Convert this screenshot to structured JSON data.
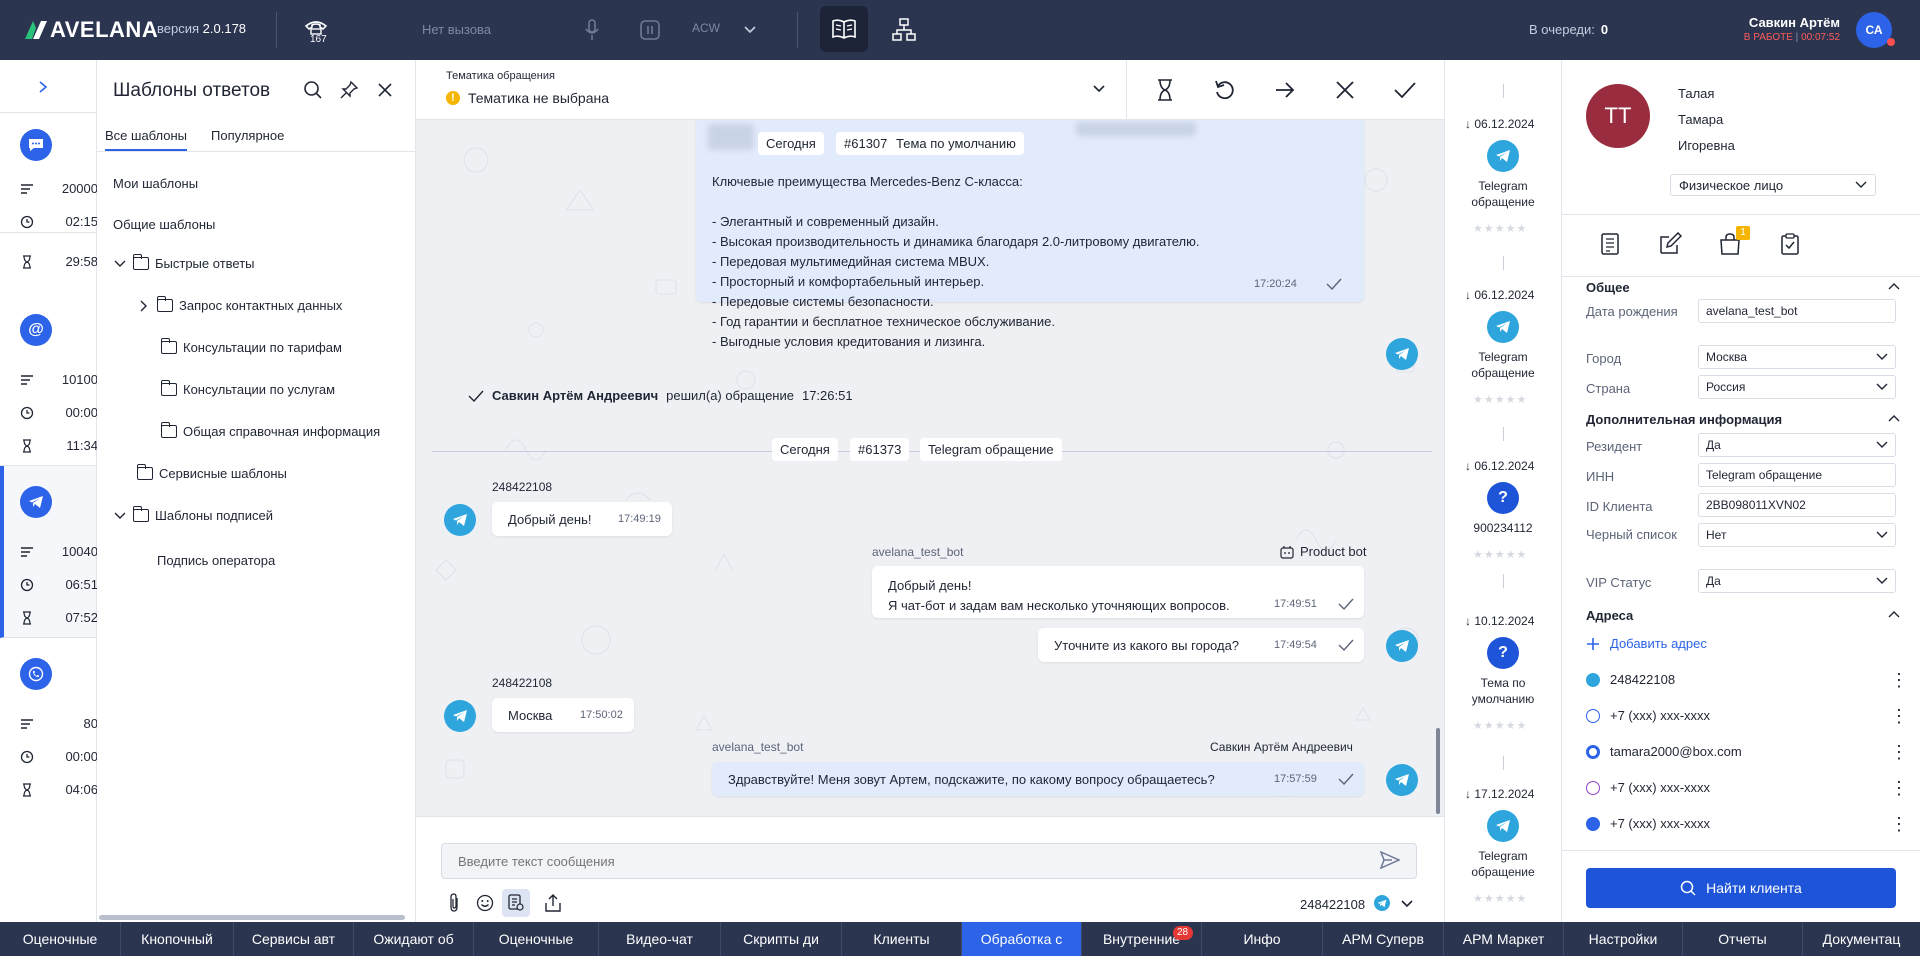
{
  "topbar": {
    "logo": "AVELANA",
    "version_label": "версия",
    "version": "2.0.178",
    "phone_count": "167",
    "call_status": "Нет вызова",
    "acw_label": "ACW",
    "queue_label": "В очереди:",
    "queue_count": "0",
    "user_name": "Савкин Артём",
    "user_status": "В РАБОТЕ",
    "user_timer": "00:07:52",
    "user_initials": "СА"
  },
  "channels": [
    {
      "icon": "chat-icon",
      "count": "20000",
      "time": "02:15",
      "wait": "29:58"
    },
    {
      "icon": "email-icon",
      "count": "10100",
      "time": "00:00",
      "wait": "11:34"
    },
    {
      "icon": "telegram-icon",
      "count": "10040",
      "time": "06:51",
      "wait": "07:52"
    },
    {
      "icon": "phone-icon",
      "count": "80",
      "time": "00:00",
      "wait": "04:06"
    }
  ],
  "templates": {
    "title": "Шаблоны ответов",
    "tabs": [
      "Все шаблоны",
      "Популярное"
    ],
    "my": "Мои шаблоны",
    "common": "Общие шаблоны",
    "tree": [
      "Быстрые ответы",
      "Запрос контактных данных",
      "Консультации по тарифам",
      "Консультации по услугам",
      "Общая справочная информация",
      "Сервисные шаблоны",
      "Шаблоны подписей",
      "Подпись оператора"
    ]
  },
  "topic": {
    "label": "Тематика обращения",
    "value": "Тематика не выбрана"
  },
  "chat": {
    "chips1": [
      "Сегодня",
      "#61307",
      "Тема по умолчанию"
    ],
    "long_msg": [
      "Ключевые преимущества Mercedes-Benz C-класса:",
      "- Элегантный и современный дизайн.",
      "- Высокая производительность и динамика благодаря 2.0-литровому двигателю.",
      "- Передовая мультимедийная система MBUX.",
      "- Просторный и комфортабельный интерьер.",
      "- Передовые системы безопасности.",
      "- Год гарантии и бесплатное техническое обслуживание.",
      "- Выгодные условия кредитования и лизинга."
    ],
    "long_msg_time": "17:20:24",
    "resolved_name": "Савкин Артём Андреевич",
    "resolved_text": "решил(а) обращение",
    "resolved_time": "17:26:51",
    "chips2": [
      "Сегодня",
      "#61373",
      "Telegram обращение"
    ],
    "client_id": "248422108",
    "m1_text": "Добрый день!",
    "m1_time": "17:49:19",
    "bot_name": "avelana_test_bot",
    "bot_label": "Product bot",
    "m2_line1": "Добрый день!",
    "m2_line2": "Я чат-бот и задам вам несколько уточняющих вопросов.",
    "m2_time": "17:49:51",
    "m3_text": "Уточните из какого вы города?",
    "m3_time": "17:49:54",
    "m4_text": "Москва",
    "m4_time": "17:50:02",
    "operator_name": "Савкин Артём Андреевич",
    "m5_text": "Здравствуйте! Меня зовут Артем, подскажите, по какому вопросу обращаетесь?",
    "m5_time": "17:57:59"
  },
  "composer": {
    "placeholder": "Введите текст сообщения",
    "recipient": "248422108"
  },
  "history": [
    {
      "date": "06.12.2024",
      "icon": "telegram-icon",
      "name": "Telegram обращение"
    },
    {
      "date": "06.12.2024",
      "icon": "telegram-icon",
      "name": "Telegram обращение"
    },
    {
      "date": "06.12.2024",
      "icon": "question-icon",
      "name": "900234112"
    },
    {
      "date": "10.12.2024",
      "icon": "question-icon",
      "name": "Тема по умолчанию"
    },
    {
      "date": "17.12.2024",
      "icon": "telegram-icon",
      "name": "Telegram обращение"
    }
  ],
  "client": {
    "initials": "ТТ",
    "last_name": "Талая",
    "first_name": "Тамара",
    "patronymic": "Игоревна",
    "type": "Физическое лицо",
    "cart_badge": "1",
    "sec_general": "Общее",
    "f_birth_label": "Дата рождения",
    "f_birth_value": "avelana_test_bot",
    "f_city_label": "Город",
    "f_city_value": "Москва",
    "f_country_label": "Страна",
    "f_country_value": "Россия",
    "sec_extra": "Дополнительная информация",
    "f_res_label": "Резидент",
    "f_res_value": "Да",
    "f_inn_label": "ИНН",
    "f_inn_value": "Telegram обращение",
    "f_id_label": "ID Клиента",
    "f_id_value": "2BB098011XVN02",
    "f_black_label": "Черный список",
    "f_black_value": "Нет",
    "f_vip_label": "VIP Статус",
    "f_vip_value": "Да",
    "sec_addr": "Адреса",
    "add_addr": "Добавить адрес",
    "addresses": [
      "248422108",
      "+7 (xxx) xxx-xxxx",
      "tamara2000@box.com",
      "+7 (xxx) xxx-xxxx",
      "+7 (xxx) xxx-xxxx"
    ],
    "find": "Найти клиента"
  },
  "bottom_tabs": [
    "Оценочные",
    "Кнопочный",
    "Сервисы авт",
    "Ожидают об",
    "Оценочные",
    "Видео-чат",
    "Скрипты ди",
    "Клиенты",
    "Обработка с",
    "Внутренние",
    "Инфо",
    "АРМ Суперв",
    "АРМ Маркет",
    "Настройки",
    "Отчеты",
    "Документац"
  ],
  "bottom_badge": "28",
  "colors": {
    "accent": "#2d63e8",
    "topbar": "#2b3550",
    "telegram": "#2ea6dd",
    "avatar": "#9a2c3f",
    "status": "#ff5b5b"
  }
}
